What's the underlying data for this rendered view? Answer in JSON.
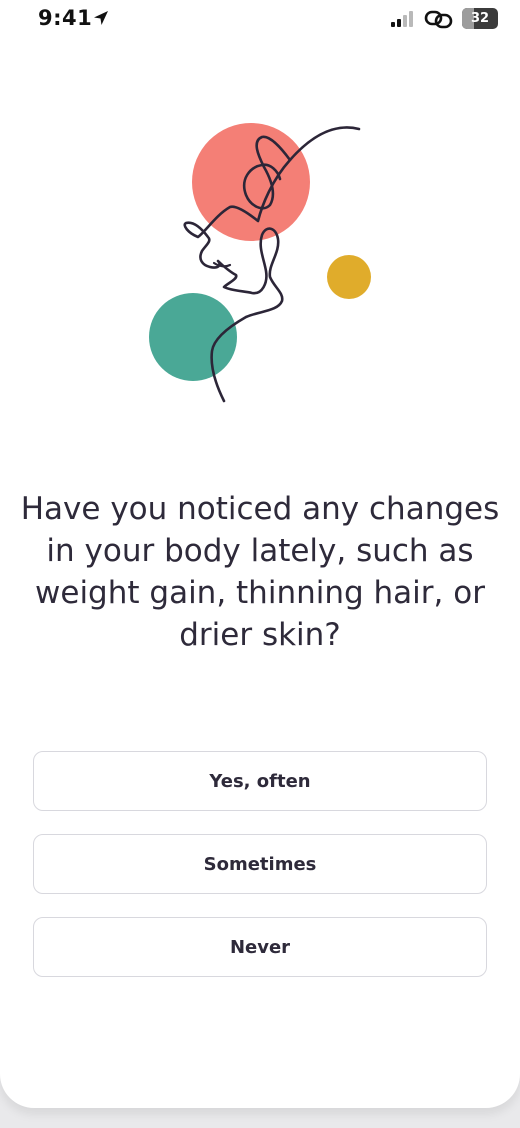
{
  "status_bar": {
    "time": "9:41",
    "battery_level": "32",
    "battery_fraction": 0.32
  },
  "icons": {
    "location": "location-arrow-icon",
    "signal": "cellular-signal-icon",
    "link": "link-icon",
    "battery": "battery-icon"
  },
  "colors": {
    "coral": "#f47f76",
    "teal": "#4aa896",
    "mustard": "#e0ac2b",
    "line": "#2c2638",
    "text": "#2e2a3a"
  },
  "question": {
    "text": "Have you noticed any changes in your body lately, such as weight gain, thinning hair, or drier skin?"
  },
  "options": [
    {
      "label": "Yes, often"
    },
    {
      "label": "Sometimes"
    },
    {
      "label": "Never"
    }
  ]
}
